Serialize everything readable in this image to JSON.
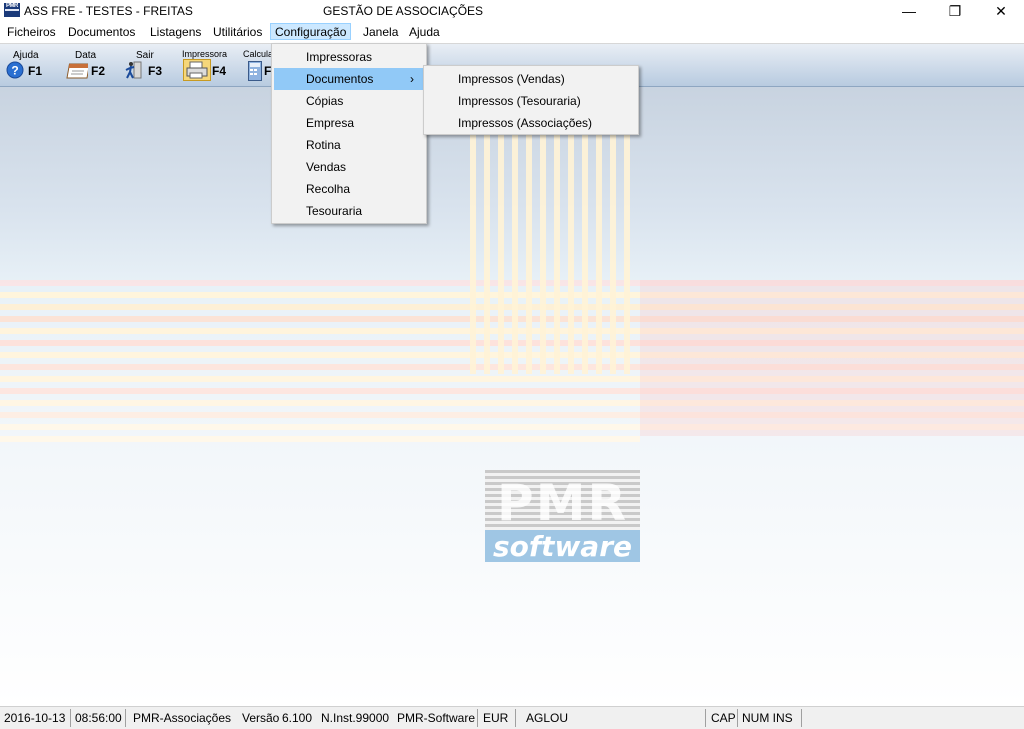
{
  "window": {
    "title_left": "ASS FRE - TESTES - FREITAS",
    "title_center": "GESTÃO DE ASSOCIAÇÕES",
    "minimize_glyph": "—",
    "restore_glyph": "❐",
    "close_glyph": "✕"
  },
  "menubar": {
    "items": [
      "Ficheiros",
      "Documentos",
      "Listagens",
      "Utilitários",
      "Configuração",
      "Janela",
      "Ajuda"
    ]
  },
  "toolbar": {
    "buttons": [
      {
        "label": "Ajuda",
        "key": "F1",
        "icon": "help-icon"
      },
      {
        "label": "Data",
        "key": "F2",
        "icon": "calendar-icon"
      },
      {
        "label": "Sair",
        "key": "F3",
        "icon": "exit-icon"
      },
      {
        "label": "Impressora",
        "key": "F4",
        "icon": "printer-icon"
      },
      {
        "label": "Calcula",
        "key": "F",
        "icon": "calculator-icon"
      }
    ]
  },
  "dropdown": {
    "items": [
      "Impressoras",
      "Documentos",
      "Cópias",
      "Empresa",
      "Rotina",
      "Vendas",
      "Recolha",
      "Tesouraria"
    ],
    "arrow": "›"
  },
  "submenu": {
    "items": [
      "Impressos (Vendas)",
      "Impressos (Tesouraria)",
      "Impressos (Associações)"
    ]
  },
  "logo": {
    "pmr": "PMR",
    "software": "software"
  },
  "statusbar": {
    "date": "2016-10-13",
    "time": "08:56:00",
    "module": "PMR-Associações",
    "version_label": "Versão",
    "version": "6.100",
    "install": "N.Inst.99000",
    "vendor": "PMR-Software",
    "currency": "EUR",
    "user": "AGLOU",
    "cap": "CAP",
    "num_ins": "NUM INS"
  },
  "colors": {
    "menu_active": "#cce8ff",
    "dropdown_highlight": "#91c9f7",
    "logo_blue": "#9fc6e4"
  }
}
